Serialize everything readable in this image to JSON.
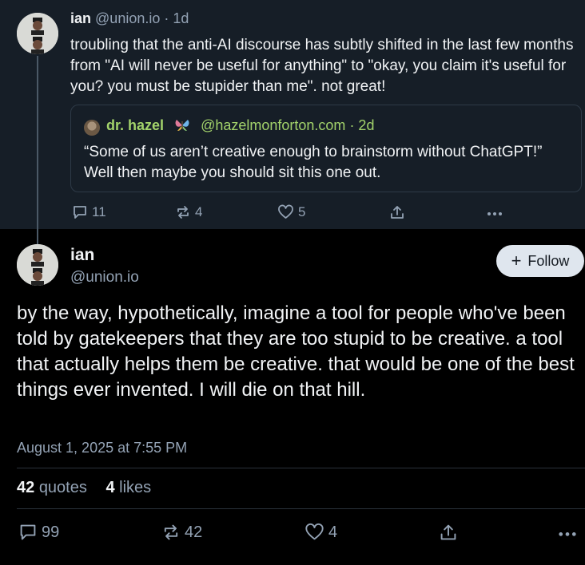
{
  "parent_post": {
    "author_name": "ian",
    "handle": "@union.io",
    "time": "· 1d",
    "text": "troubling that the anti-AI discourse has subtly shifted in the last few months from \"AI will never be useful for anything\" to \"okay, you claim it's useful for you? you must be stupider than me\". not great!",
    "quote": {
      "author_name": "dr. hazel",
      "handle": "@hazelmonforton.com",
      "time": "· 2d",
      "text": "“Some of us aren’t creative enough to brainstorm without ChatGPT!” Well then maybe you should sit this one out."
    },
    "actions": {
      "replies": "11",
      "reposts": "4",
      "likes": "5"
    }
  },
  "main_post": {
    "author_name": "ian",
    "handle": "@union.io",
    "follow_label": "Follow",
    "follow_icon": "+",
    "text": "by the way, hypothetically, imagine a tool for people who've been told by gatekeepers that they are too stupid to be creative. a tool that actually helps them be creative. that would be one of the best things ever invented. I will die on that hill.",
    "timestamp": "August 1, 2025 at 7:55 PM",
    "stats": {
      "quotes_count": "42",
      "quotes_label": "quotes",
      "likes_count": "4",
      "likes_label": "likes"
    },
    "actions": {
      "replies": "99",
      "reposts": "42",
      "likes": "4"
    }
  },
  "colors": {
    "parent_bg": "#161e27",
    "page_bg": "#000000",
    "text": "#f1f3f5",
    "muted": "#93a2b4",
    "quote_accent": "#a3d36b",
    "follow_bg": "#dfe6ee"
  }
}
